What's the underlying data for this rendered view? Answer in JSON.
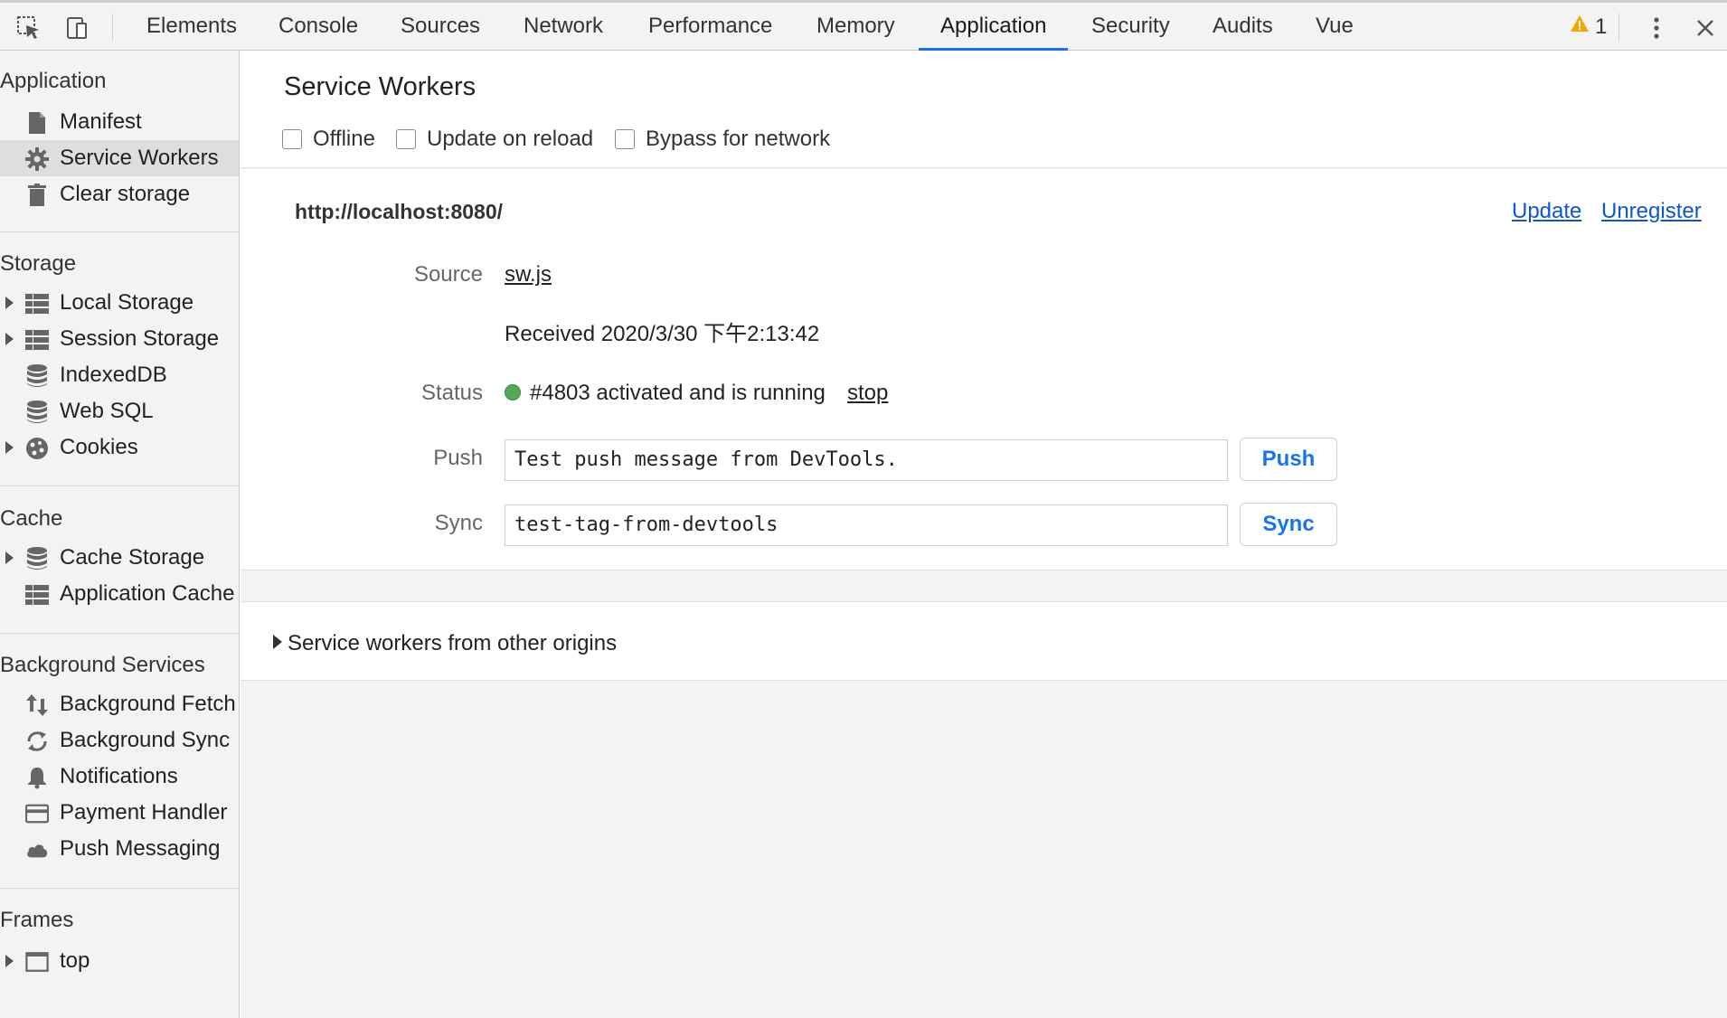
{
  "toolbar": {
    "tabs": [
      "Elements",
      "Console",
      "Sources",
      "Network",
      "Performance",
      "Memory",
      "Application",
      "Security",
      "Audits",
      "Vue"
    ],
    "active_tab": "Application",
    "warning_count": "1",
    "icons": [
      "inspect-element-icon",
      "device-toolbar-icon",
      "warning-icon",
      "more-options-icon",
      "close-icon"
    ]
  },
  "sidebar": {
    "application": {
      "title": "Application",
      "items": [
        {
          "label": "Manifest",
          "icon": "document-icon"
        },
        {
          "label": "Service Workers",
          "icon": "gear-icon",
          "selected": true
        },
        {
          "label": "Clear storage",
          "icon": "trash-icon"
        }
      ]
    },
    "storage": {
      "title": "Storage",
      "items": [
        {
          "label": "Local Storage",
          "icon": "table-icon"
        },
        {
          "label": "Session Storage",
          "icon": "table-icon"
        },
        {
          "label": "IndexedDB",
          "icon": "database-icon"
        },
        {
          "label": "Web SQL",
          "icon": "database-icon"
        },
        {
          "label": "Cookies",
          "icon": "cookie-icon"
        }
      ]
    },
    "cache": {
      "title": "Cache",
      "items": [
        {
          "label": "Cache Storage",
          "icon": "database-icon"
        },
        {
          "label": "Application Cache",
          "icon": "table-icon"
        }
      ]
    },
    "background": {
      "title": "Background Services",
      "items": [
        {
          "label": "Background Fetch",
          "icon": "up-down-arrows-icon"
        },
        {
          "label": "Background Sync",
          "icon": "sync-icon"
        },
        {
          "label": "Notifications",
          "icon": "bell-icon"
        },
        {
          "label": "Payment Handler",
          "icon": "credit-card-icon"
        },
        {
          "label": "Push Messaging",
          "icon": "cloud-icon"
        }
      ]
    },
    "frames": {
      "title": "Frames",
      "items": [
        {
          "label": "top",
          "icon": "frame-icon"
        }
      ]
    }
  },
  "main": {
    "title": "Service Workers",
    "options": {
      "offline": "Offline",
      "update_on_reload": "Update on reload",
      "bypass_for_network": "Bypass for network"
    },
    "worker": {
      "origin": "http://localhost:8080/",
      "update_label": "Update",
      "unregister_label": "Unregister",
      "source_label": "Source",
      "source_value": "sw.js",
      "received": "Received 2020/3/30 下午2:13:42",
      "status_label": "Status",
      "status_text": "#4803 activated and is running",
      "status_color": "#57a75b",
      "stop_label": "stop",
      "push_label": "Push",
      "push_value": "Test push message from DevTools.",
      "push_button": "Push",
      "sync_label": "Sync",
      "sync_value": "test-tag-from-devtools",
      "sync_button": "Sync"
    },
    "other_origins": "Service workers from other origins"
  }
}
